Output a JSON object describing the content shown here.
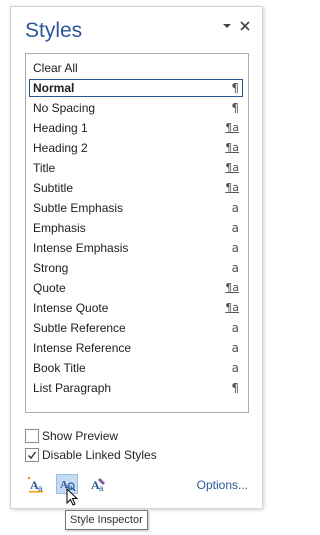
{
  "pane": {
    "title": "Styles",
    "dropdown_icon": "chevron-down-icon",
    "close_icon": "close-icon"
  },
  "styles": {
    "selected_index": 1,
    "items": [
      {
        "label": "Clear All",
        "glyph": ""
      },
      {
        "label": "Normal",
        "glyph": "¶"
      },
      {
        "label": "No Spacing",
        "glyph": "¶"
      },
      {
        "label": "Heading 1",
        "glyph": "¶a"
      },
      {
        "label": "Heading 2",
        "glyph": "¶a"
      },
      {
        "label": "Title",
        "glyph": "¶a"
      },
      {
        "label": "Subtitle",
        "glyph": "¶a"
      },
      {
        "label": "Subtle Emphasis",
        "glyph": "a"
      },
      {
        "label": "Emphasis",
        "glyph": "a"
      },
      {
        "label": "Intense Emphasis",
        "glyph": "a"
      },
      {
        "label": "Strong",
        "glyph": "a"
      },
      {
        "label": "Quote",
        "glyph": "¶a"
      },
      {
        "label": "Intense Quote",
        "glyph": "¶a"
      },
      {
        "label": "Subtle Reference",
        "glyph": "a"
      },
      {
        "label": "Intense Reference",
        "glyph": "a"
      },
      {
        "label": "Book Title",
        "glyph": "a"
      },
      {
        "label": "List Paragraph",
        "glyph": "¶"
      }
    ]
  },
  "options": {
    "show_preview": {
      "label": "Show Preview",
      "checked": false
    },
    "disable_linked": {
      "label": "Disable Linked Styles",
      "checked": true
    }
  },
  "toolbar": {
    "new_style_icon": "new-style-icon",
    "style_inspector_icon": "style-inspector-icon",
    "manage_styles_icon": "manage-styles-icon",
    "options_link": "Options..."
  },
  "tooltip": "Style Inspector",
  "colors": {
    "accent": "#2b579a",
    "active_button": "#c5dcf2"
  }
}
